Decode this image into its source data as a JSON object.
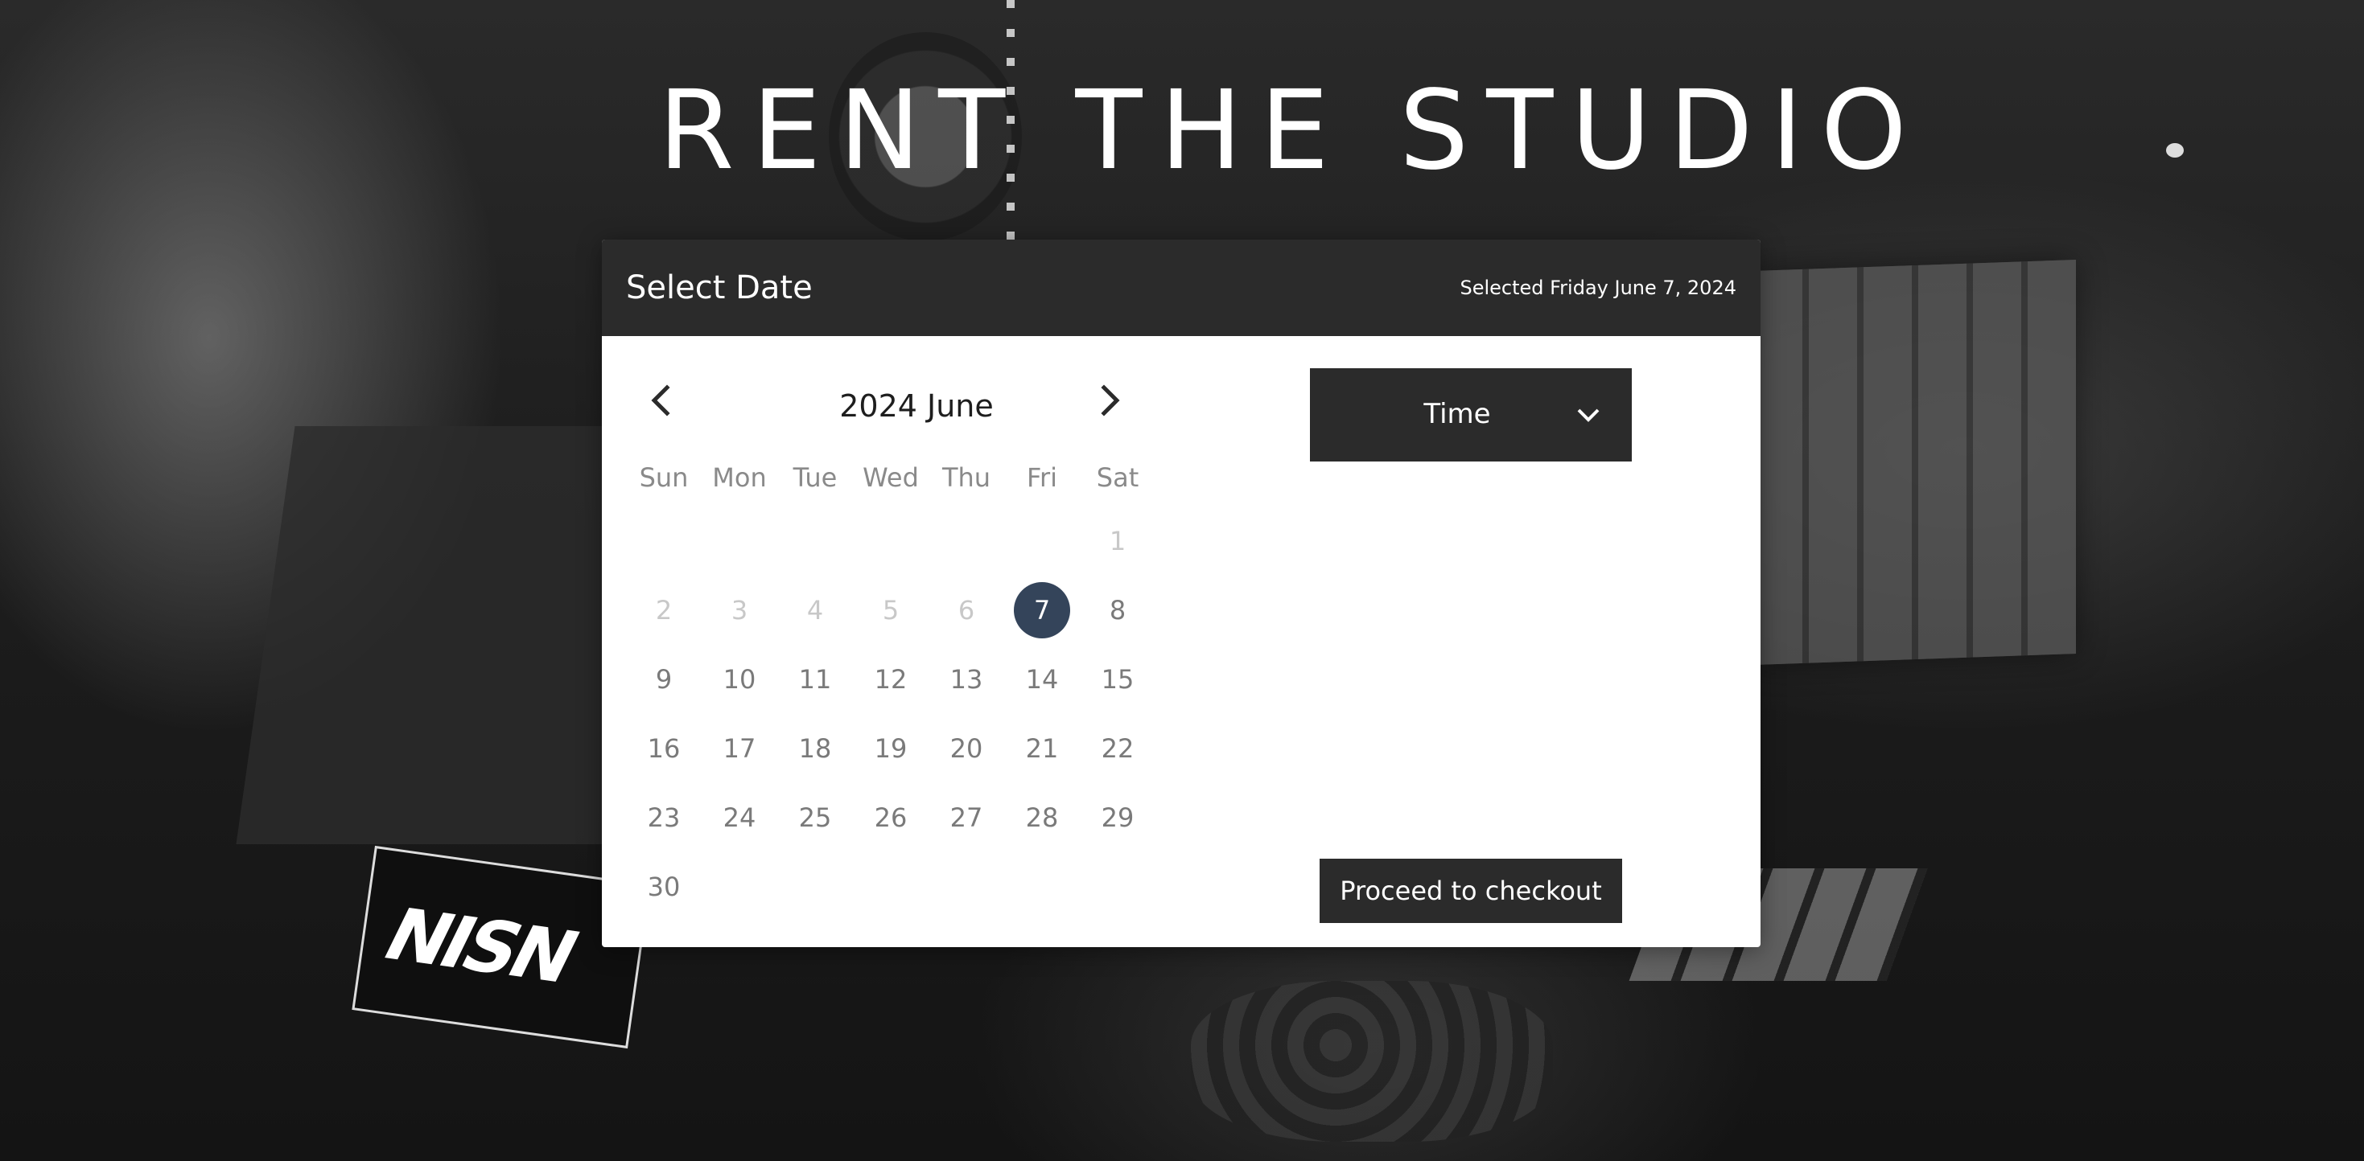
{
  "page": {
    "title": "RENT THE STUDIO"
  },
  "colors": {
    "header_bg": "#2b2b2b",
    "selected_day": "#34445a",
    "card_bg": "#ffffff",
    "disabled_day": "#c8c8c8",
    "day_text": "#7a7a7a"
  },
  "card": {
    "header_title": "Select Date",
    "selected_text": "Selected Friday June 7, 2024"
  },
  "calendar": {
    "month_label": "2024 June",
    "prev_icon": "chevron-left-icon",
    "next_icon": "chevron-right-icon",
    "weekdays": [
      "Sun",
      "Mon",
      "Tue",
      "Wed",
      "Thu",
      "Fri",
      "Sat"
    ],
    "weeks": [
      [
        "",
        "",
        "",
        "",
        "",
        "",
        "1"
      ],
      [
        "2",
        "3",
        "4",
        "5",
        "6",
        "7",
        "8"
      ],
      [
        "9",
        "10",
        "11",
        "12",
        "13",
        "14",
        "15"
      ],
      [
        "16",
        "17",
        "18",
        "19",
        "20",
        "21",
        "22"
      ],
      [
        "23",
        "24",
        "25",
        "26",
        "27",
        "28",
        "29"
      ],
      [
        "30",
        "",
        "",
        "",
        "",
        "",
        ""
      ]
    ],
    "disabled_days": [
      "1",
      "2",
      "3",
      "4",
      "5",
      "6"
    ],
    "selected_day": "7"
  },
  "time_select": {
    "label": "Time",
    "icon": "chevron-down-icon"
  },
  "checkout": {
    "label": "Proceed to checkout"
  },
  "background": {
    "sticker_text": "NISN"
  }
}
